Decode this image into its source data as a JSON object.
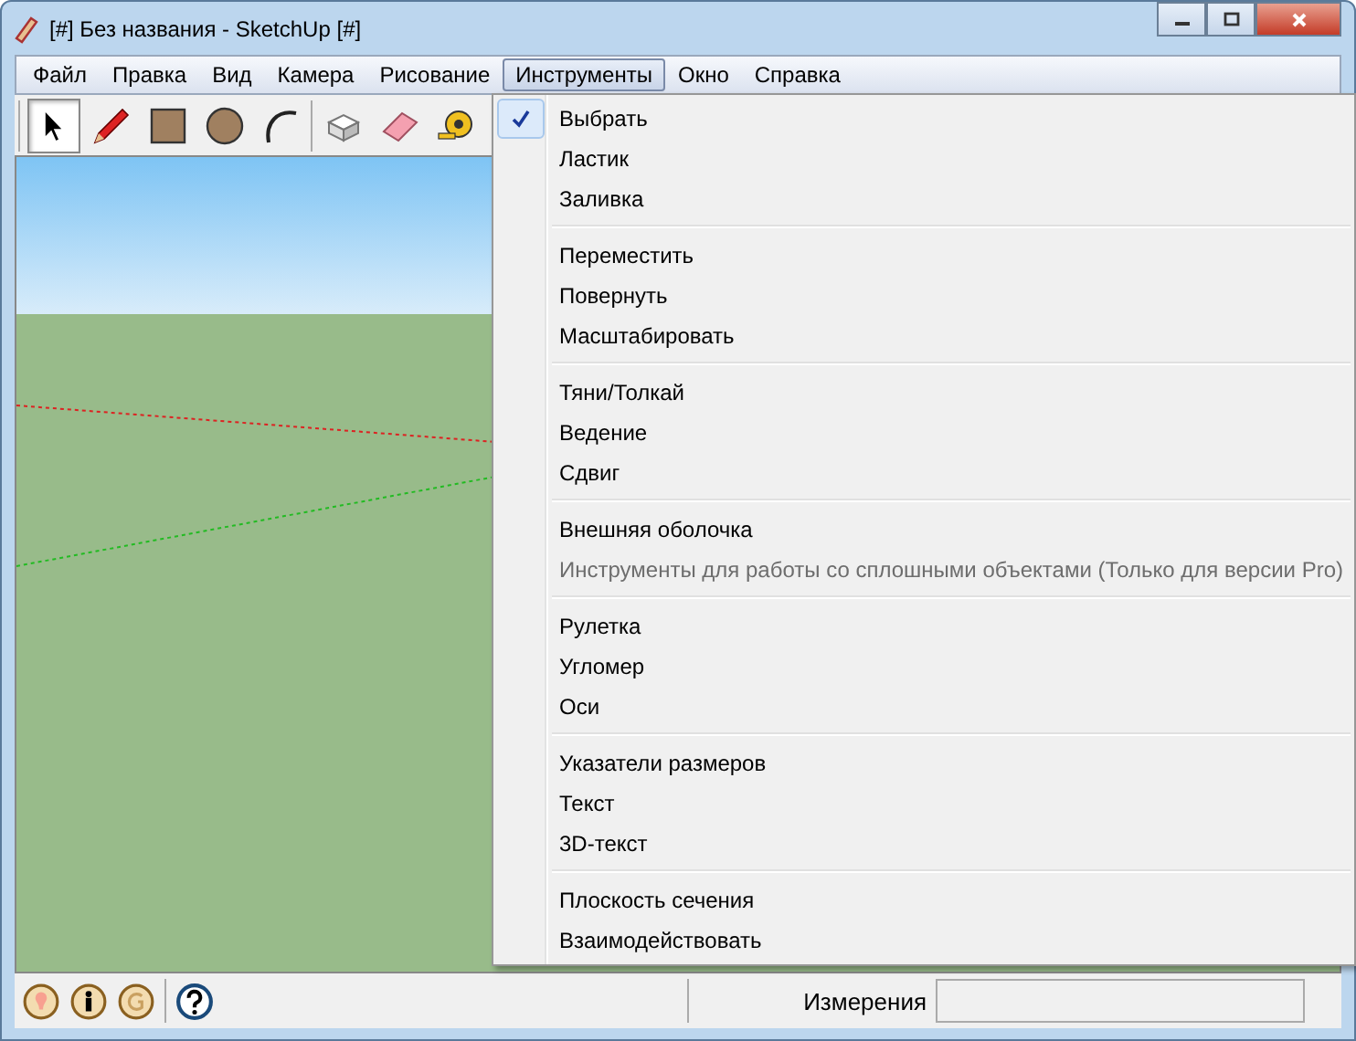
{
  "window": {
    "title": "[#] Без названия - SketchUp [#]"
  },
  "menu_bar": [
    {
      "label": "Файл",
      "selected": false
    },
    {
      "label": "Правка",
      "selected": false
    },
    {
      "label": "Вид",
      "selected": false
    },
    {
      "label": "Камера",
      "selected": false
    },
    {
      "label": "Рисование",
      "selected": false
    },
    {
      "label": "Инструменты",
      "selected": true
    },
    {
      "label": "Окно",
      "selected": false
    },
    {
      "label": "Справка",
      "selected": false
    }
  ],
  "toolbar": [
    {
      "kind": "select",
      "selected": true
    },
    {
      "kind": "pencil",
      "selected": false
    },
    {
      "kind": "rectangle",
      "selected": false
    },
    {
      "kind": "circle",
      "selected": false
    },
    {
      "kind": "arc",
      "selected": false
    },
    {
      "kind": "separator"
    },
    {
      "kind": "box",
      "selected": false
    },
    {
      "kind": "eraser",
      "selected": false
    },
    {
      "kind": "tape",
      "selected": false
    }
  ],
  "dropdown": {
    "groups": [
      [
        {
          "label": "Выбрать",
          "checked": true,
          "disabled": false
        },
        {
          "label": "Ластик",
          "checked": false,
          "disabled": false
        },
        {
          "label": "Заливка",
          "checked": false,
          "disabled": false
        }
      ],
      [
        {
          "label": "Переместить",
          "checked": false,
          "disabled": false
        },
        {
          "label": "Повернуть",
          "checked": false,
          "disabled": false
        },
        {
          "label": "Масштабировать",
          "checked": false,
          "disabled": false
        }
      ],
      [
        {
          "label": "Тяни/Толкай",
          "checked": false,
          "disabled": false
        },
        {
          "label": "Ведение",
          "checked": false,
          "disabled": false
        },
        {
          "label": "Сдвиг",
          "checked": false,
          "disabled": false
        }
      ],
      [
        {
          "label": "Внешняя оболочка",
          "checked": false,
          "disabled": false
        },
        {
          "label": "Инструменты для работы со сплошными объектами (Только для версии Pro)",
          "checked": false,
          "disabled": true
        }
      ],
      [
        {
          "label": "Рулетка",
          "checked": false,
          "disabled": false
        },
        {
          "label": "Угломер",
          "checked": false,
          "disabled": false
        },
        {
          "label": "Оси",
          "checked": false,
          "disabled": false
        }
      ],
      [
        {
          "label": "Указатели размеров",
          "checked": false,
          "disabled": false
        },
        {
          "label": "Текст",
          "checked": false,
          "disabled": false
        },
        {
          "label": "3D-текст",
          "checked": false,
          "disabled": false
        }
      ],
      [
        {
          "label": "Плоскость сечения",
          "checked": false,
          "disabled": false
        },
        {
          "label": "Взаимодействовать",
          "checked": false,
          "disabled": false
        }
      ]
    ]
  },
  "status_bar": {
    "label": "Измерения"
  }
}
